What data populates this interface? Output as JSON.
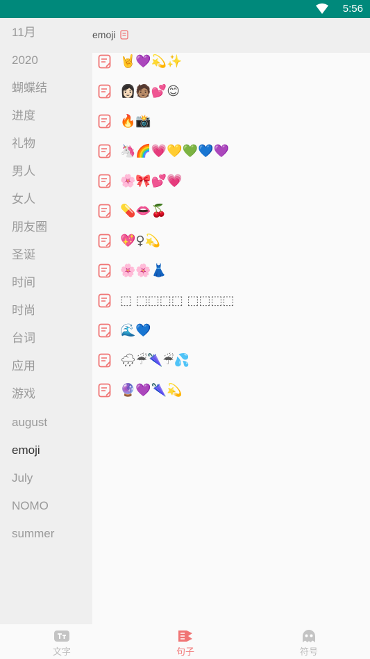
{
  "status_bar": {
    "time": "5:56"
  },
  "sidebar": {
    "items": [
      {
        "label": "11月"
      },
      {
        "label": "2020"
      },
      {
        "label": "蝴蝶结"
      },
      {
        "label": "进度"
      },
      {
        "label": "礼物"
      },
      {
        "label": "男人"
      },
      {
        "label": "女人"
      },
      {
        "label": "朋友圈"
      },
      {
        "label": "圣诞"
      },
      {
        "label": "时间"
      },
      {
        "label": "时尚"
      },
      {
        "label": "台词"
      },
      {
        "label": "应用"
      },
      {
        "label": "游戏"
      },
      {
        "label": "august"
      },
      {
        "label": "emoji"
      },
      {
        "label": "July"
      },
      {
        "label": "NOMO"
      },
      {
        "label": "summer"
      }
    ],
    "active_index": 15
  },
  "header": {
    "title": "emoji"
  },
  "rows": [
    {
      "text": "🤘💜💫✨"
    },
    {
      "text": "👩🏻🧑🏽💕😊"
    },
    {
      "text": "🔥📸"
    },
    {
      "text": "🦄🌈💗💛💚💙💜"
    },
    {
      "text": "🌸🎀💕💗"
    },
    {
      "text": "💊👄🍒"
    },
    {
      "text": "💖♀💫"
    },
    {
      "text": "🌸🌸👗"
    },
    {
      "text": "⬚ ⬚⬚⬚⬚ ⬚⬚⬚⬚"
    },
    {
      "text": "🌊💙"
    },
    {
      "text": "🌧☔🌂☔💦"
    },
    {
      "text": "🔮💜🌂💫"
    }
  ],
  "tabs": [
    {
      "label": "文字",
      "icon": "text-icon"
    },
    {
      "label": "句子",
      "icon": "sentence-icon"
    },
    {
      "label": "符号",
      "icon": "ghost-icon"
    }
  ],
  "colors": {
    "status_bar": "#00897b",
    "accent": "#f07575"
  }
}
